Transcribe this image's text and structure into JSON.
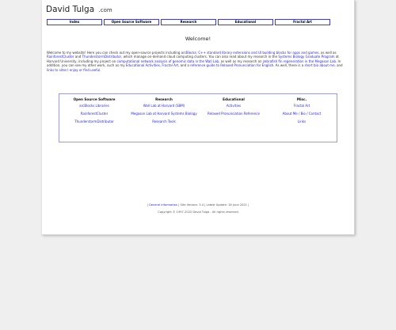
{
  "header": {
    "title": "David Tulga",
    "tld": ".com"
  },
  "nav": [
    {
      "label": "Index"
    },
    {
      "label": "Open Source Software"
    },
    {
      "label": "Research"
    },
    {
      "label": "Educational"
    },
    {
      "label": "Fractal Art"
    }
  ],
  "welcome": "Welcome!",
  "intro": {
    "t1": "Welcome to my website!  Here you can check out my open-source projects including ",
    "l1": "arcBlocks: C++ standard library extensions and UI building blocks for apps and games",
    "t2": ", as well as ",
    "l2": "RainforestCluster",
    "t3": " and ",
    "l3": "ThunderstormDistributor",
    "t4": ", which manage on-demand cloud computing clusters.  You can also read about my research in the ",
    "l4": "Systems Biology Graduate Program",
    "t5": " at Harvard University, including my project on ",
    "l5": "computational network analysis of genomic data in the Wall Lab",
    "t6": ", as well as my research on ",
    "l6": "zebrafish fin regeneration in the Megason Lab",
    "t7": ".  In addition, you can see my other work, such as my ",
    "l7": "Educational Activities",
    "t8": ", ",
    "l8": "Fractal Art",
    "t9": ", and a ",
    "l9": "reference guide to Relaxed Pronunciation for English",
    "t10": ".  As well, there is a ",
    "l10": "short bio about me",
    "t11": ", and ",
    "l11": "links to sites I enjoy or find useful",
    "t12": "."
  },
  "menu": {
    "columns": [
      {
        "heading": "Open Source Software",
        "links": [
          "arcBlocks Libraries",
          "RainforestCluster",
          "ThunderstormDistributor"
        ]
      },
      {
        "heading": "Research",
        "links": [
          "Wall Lab at Harvard (SBM)",
          "Megason Lab at Harvard Systems Biology",
          "Research Tools"
        ]
      },
      {
        "heading": "Educational",
        "links": [
          "Activities",
          "Relaxed Pronunciation Reference"
        ]
      },
      {
        "heading": "Misc.",
        "links": [
          "Fractal Art",
          "About Me / Bio / Contact",
          "Links"
        ]
      }
    ]
  },
  "footer": {
    "sep": "|",
    "general": "General Information",
    "version": "Site Version: 3.4",
    "updated": "Latest Update: 18 June 2021",
    "copyright": "Copyright © 1997-2022 David Tulga - All rights reserved"
  },
  "colors": {
    "link": "#2727d6",
    "nav_border": "#3d3dc8",
    "box_border": "#9b9bd6",
    "background": "#efefef"
  }
}
